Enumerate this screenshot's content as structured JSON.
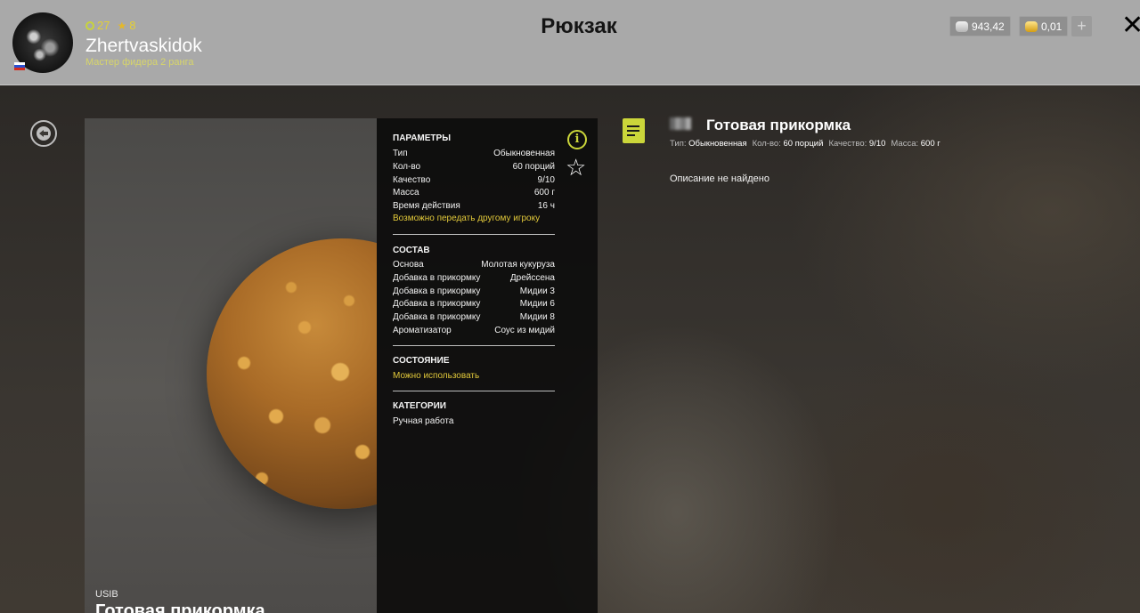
{
  "header": {
    "title": "Рюкзак",
    "player": {
      "level": "27",
      "stars": "8",
      "name": "Zhertvaskidok",
      "rank": "Мастер фидера 2 ранга"
    },
    "currency": {
      "silver": "943,42",
      "gold": "0,01"
    },
    "add_label": "+",
    "close_label": "✕"
  },
  "item_preview": {
    "brand": "USIB",
    "name": "Готовая прикормка"
  },
  "info_panel": {
    "params": {
      "title": "ПАРАМЕТРЫ",
      "rows": [
        {
          "label": "Тип",
          "value": "Обыкновенная"
        },
        {
          "label": "Кол-во",
          "value": "60 порций"
        },
        {
          "label": "Качество",
          "value": "9/10"
        },
        {
          "label": "Масса",
          "value": "600 г"
        },
        {
          "label": "Время действия",
          "value": "16 ч"
        }
      ],
      "transfer_note": "Возможно передать другому игроку"
    },
    "composition": {
      "title": "СОСТАВ",
      "rows": [
        {
          "label": "Основа",
          "value": "Молотая кукуруза"
        },
        {
          "label": "Добавка в прикормку",
          "value": "Дрейссена"
        },
        {
          "label": "Добавка в прикормку",
          "value": "Мидии 3"
        },
        {
          "label": "Добавка в прикормку",
          "value": "Мидии 6"
        },
        {
          "label": "Добавка в прикормку",
          "value": "Мидии 8"
        },
        {
          "label": "Ароматизатор",
          "value": "Соус из мидий"
        }
      ]
    },
    "state": {
      "title": "СОСТОЯНИЕ",
      "value": "Можно использовать"
    },
    "categories": {
      "title": "КАТЕГОРИИ",
      "value": "Ручная работа"
    },
    "info_label": "i",
    "favorite_label": "☆"
  },
  "details": {
    "title": "Готовая прикормка",
    "meta": [
      {
        "key": "Тип:",
        "value": "Обыкновенная"
      },
      {
        "key": "Кол-во:",
        "value": "60 порций"
      },
      {
        "key": "Качество:",
        "value": "9/10"
      },
      {
        "key": "Масса:",
        "value": "600 г"
      }
    ],
    "description": "Описание не найдено"
  }
}
